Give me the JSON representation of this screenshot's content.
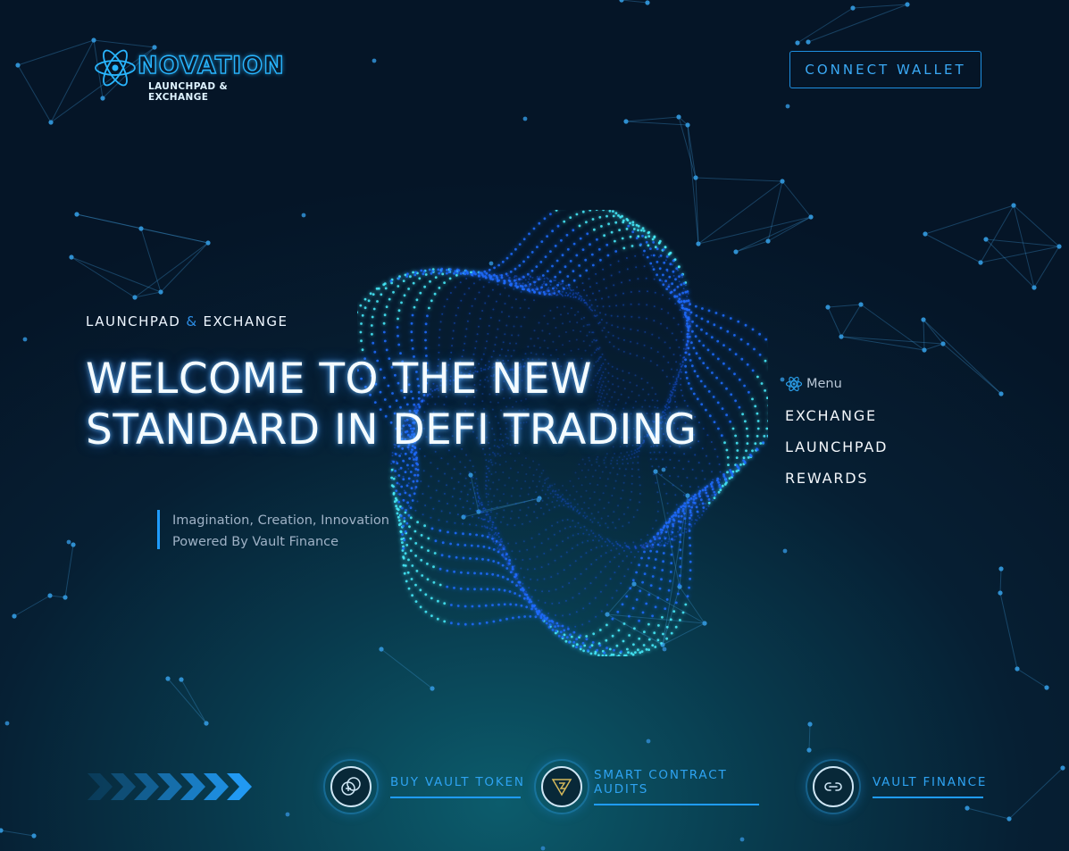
{
  "brand": {
    "name": "NOVATION",
    "tagline": "LAUNCHPAD & EXCHANGE",
    "logo_icon": "atom-icon"
  },
  "header": {
    "connect_label": "CONNECT WALLET"
  },
  "hero": {
    "eyebrow_left": "LAUNCHPAD",
    "eyebrow_amp": "&",
    "eyebrow_right": "EXCHANGE",
    "headline_line1": "WELCOME TO THE NEW",
    "headline_line2": "STANDARD IN DEFI TRADING",
    "tagline_line1": "Imagination, Creation, Innovation",
    "tagline_line2": "Powered By Vault Finance"
  },
  "menu": {
    "title": "Menu",
    "items": [
      {
        "label": "EXCHANGE"
      },
      {
        "label": "LAUNCHPAD"
      },
      {
        "label": "REWARDS"
      }
    ]
  },
  "footer": {
    "items": [
      {
        "label": "BUY VAULT TOKEN",
        "icon": "coins-icon"
      },
      {
        "label_line1": "SMART CONTRACT",
        "label_line2": "AUDITS",
        "icon": "audit-shield-icon"
      },
      {
        "label": "VAULT FINANCE",
        "icon": "link-icon"
      }
    ]
  },
  "colors": {
    "accent": "#1f9cff",
    "accent_text": "#2ea3f2",
    "background_dark": "#051527",
    "background_glow": "#0c5c6c",
    "blob_cyan": "#46f0ff",
    "blob_blue": "#1f6bff"
  }
}
